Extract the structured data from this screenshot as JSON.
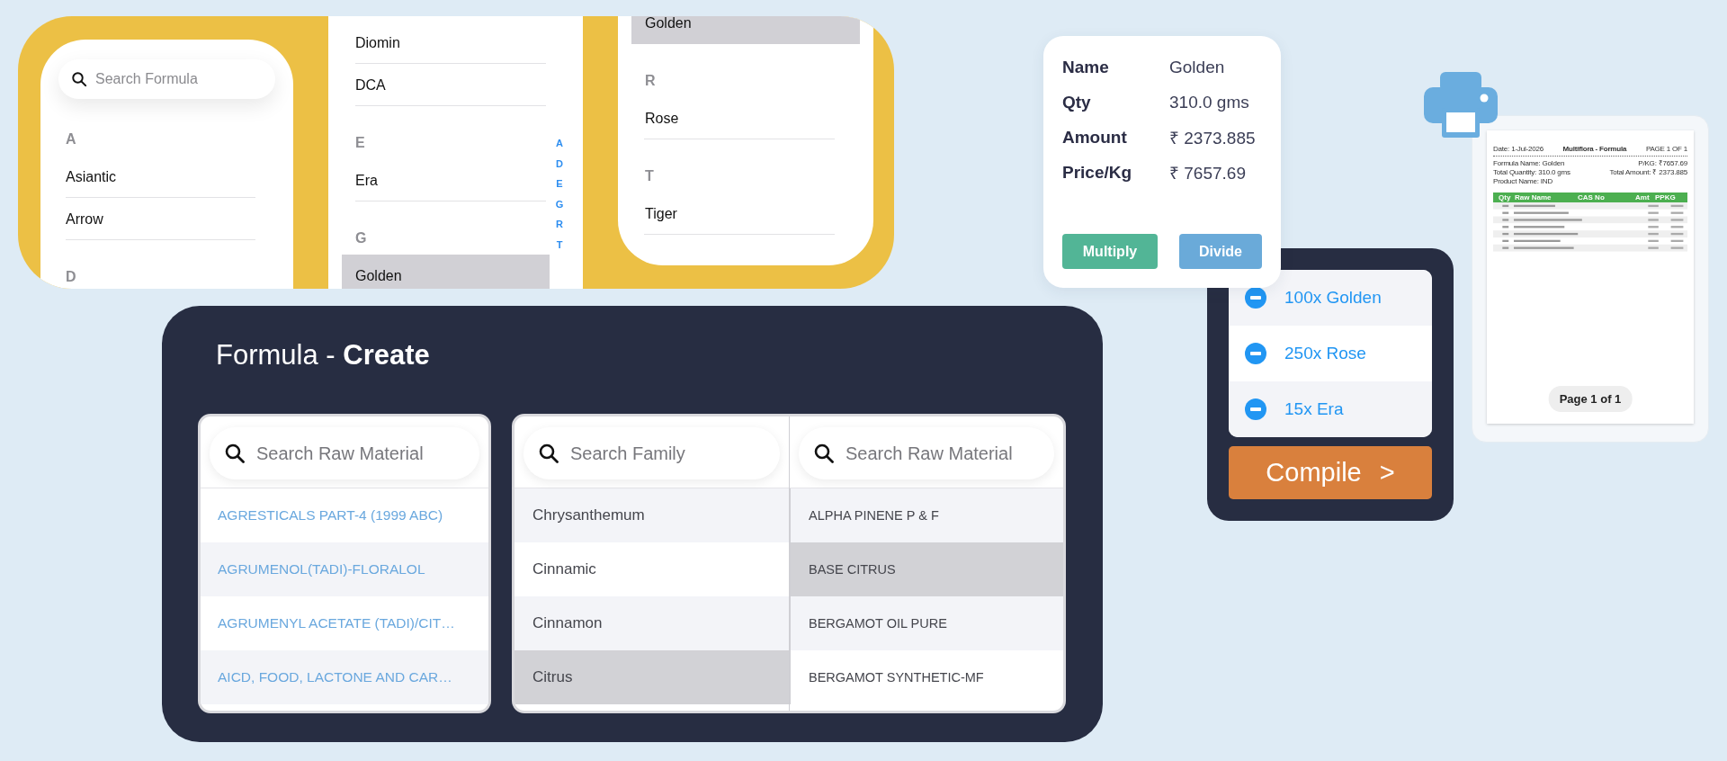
{
  "formula_browser": {
    "search": {
      "placeholder": "Search Formula"
    },
    "left_sections": [
      {
        "header": "A",
        "items": [
          {
            "label": "Asiantic",
            "selected": false
          },
          {
            "label": "Arrow",
            "selected": false
          }
        ]
      },
      {
        "header": "D"
      }
    ],
    "middle_sections": [
      {
        "items": [
          {
            "label": "Diomin",
            "selected": false
          },
          {
            "label": "DCA",
            "selected": false
          }
        ]
      },
      {
        "header": "E",
        "items": [
          {
            "label": "Era",
            "selected": false
          }
        ]
      },
      {
        "header": "G",
        "items": [
          {
            "label": "Golden",
            "selected": true
          }
        ]
      }
    ],
    "index_letters": [
      "A",
      "D",
      "E",
      "G",
      "R",
      "T"
    ],
    "right_sections": [
      {
        "items": [
          {
            "label": "Golden",
            "selected": true
          }
        ]
      },
      {
        "header": "R",
        "items": [
          {
            "label": "Rose",
            "selected": false
          }
        ]
      },
      {
        "header": "T",
        "items": [
          {
            "label": "Tiger",
            "selected": false
          }
        ]
      }
    ]
  },
  "formula_create": {
    "title": "Formula - **Create**",
    "raw_materials": {
      "search": {
        "placeholder": "Search Raw Material"
      },
      "items": [
        {
          "label": "AGRESTICALS PART-4 (1999 ABC)",
          "selected": false
        },
        {
          "label": "AGRUMENOL(TADI)-FLORALOL",
          "selected": false
        },
        {
          "label": "AGRUMENYL ACETATE (TADI)/CIT…",
          "selected": false
        },
        {
          "label": "AICD, FOOD, LACTONE AND CAR…",
          "selected": false
        }
      ]
    },
    "families": {
      "search": {
        "placeholder": "Search Family"
      },
      "items": [
        {
          "label": "Chrysanthemum",
          "selected": false
        },
        {
          "label": "Cinnamic",
          "selected": false
        },
        {
          "label": "Cinnamon",
          "selected": false
        },
        {
          "label": "Citrus",
          "selected": true
        }
      ]
    },
    "family_materials": {
      "search": {
        "placeholder": "Search Raw Material"
      },
      "items": [
        {
          "label": "ALPHA PINENE P & F",
          "selected": false
        },
        {
          "label": "BASE CITRUS",
          "selected": true
        },
        {
          "label": "BERGAMOT OIL PURE",
          "selected": false
        },
        {
          "label": "BERGAMOT SYNTHETIC-MF",
          "selected": false
        }
      ]
    }
  },
  "summary": {
    "rows": [
      {
        "label": "Name",
        "value": "Golden"
      },
      {
        "label": "Qty",
        "value": "310.0 gms"
      },
      {
        "label": "Amount",
        "value": "₹ 2373.885"
      },
      {
        "label": "Price/Kg",
        "value": "₹ 7657.69"
      }
    ],
    "buttons": [
      {
        "label": "Multiply",
        "kind": "multiply"
      },
      {
        "label": "Divide",
        "kind": "divide"
      }
    ]
  },
  "compile": {
    "items": [
      {
        "label": "100x Golden"
      },
      {
        "label": "250x Rose"
      },
      {
        "label": "15x Era"
      }
    ],
    "button": {
      "label": "Compile",
      "chevron": ">"
    }
  },
  "print_preview": {
    "page": {
      "date": "Date: 1-Jul-2026",
      "title": "Multiflora - Formula",
      "page_number": "PAGE 1 OF 1",
      "formula_name": "Formula Name: Golden",
      "total_quantity": "Total Quantity: 310.0 gms",
      "product_name": "Product Name: IND",
      "price_per_kg": "P/KG: ₹7657.69",
      "total_amount": "Total Amount: ₹ 2373.885",
      "columns": [
        "Qty",
        "Raw Name",
        "CAS No",
        "Amt",
        "PPKG"
      ]
    },
    "page_indicator": "Page 1 of 1"
  }
}
